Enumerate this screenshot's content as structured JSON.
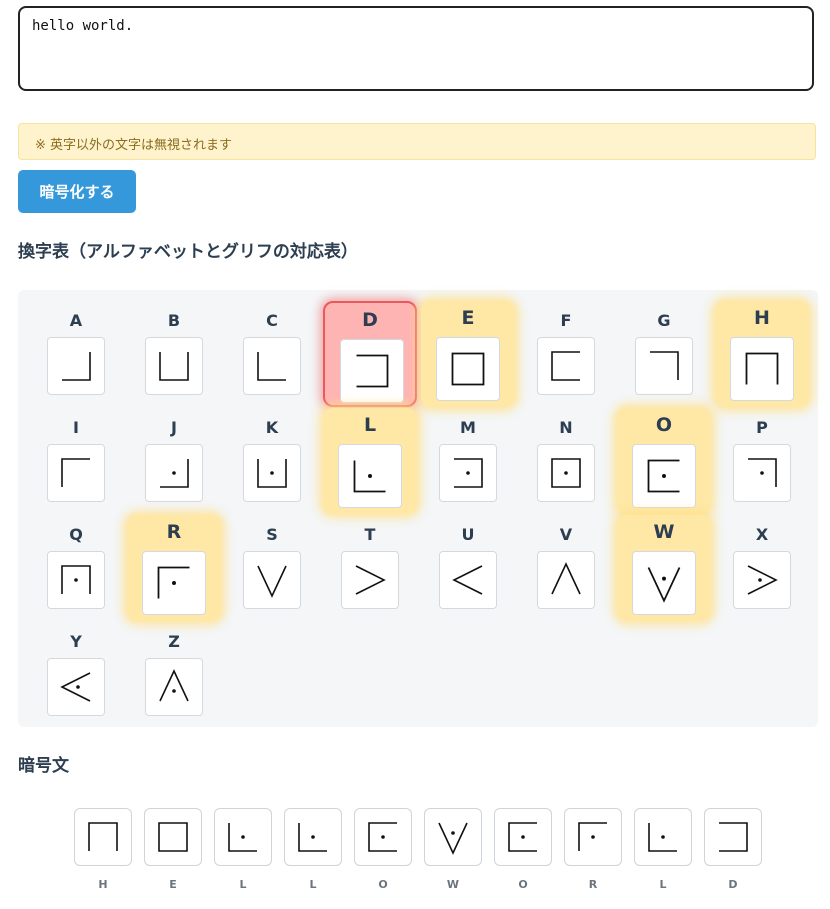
{
  "input": {
    "value": "hello world."
  },
  "notice": {
    "text": "※ 英字以外の文字は無視されます"
  },
  "encode_button": {
    "label": "暗号化する"
  },
  "table_heading": "換字表（アルファベットとグリフの対応表）",
  "cipher_heading": "暗号文",
  "alphabet": [
    {
      "letter": "A",
      "state": "normal"
    },
    {
      "letter": "B",
      "state": "normal"
    },
    {
      "letter": "C",
      "state": "normal"
    },
    {
      "letter": "D",
      "state": "current"
    },
    {
      "letter": "E",
      "state": "highlighted"
    },
    {
      "letter": "F",
      "state": "normal"
    },
    {
      "letter": "G",
      "state": "normal"
    },
    {
      "letter": "H",
      "state": "highlighted"
    },
    {
      "letter": "I",
      "state": "normal"
    },
    {
      "letter": "J",
      "state": "normal"
    },
    {
      "letter": "K",
      "state": "normal"
    },
    {
      "letter": "L",
      "state": "highlighted"
    },
    {
      "letter": "M",
      "state": "normal"
    },
    {
      "letter": "N",
      "state": "normal"
    },
    {
      "letter": "O",
      "state": "highlighted"
    },
    {
      "letter": "P",
      "state": "normal"
    },
    {
      "letter": "Q",
      "state": "normal"
    },
    {
      "letter": "R",
      "state": "highlighted"
    },
    {
      "letter": "S",
      "state": "normal"
    },
    {
      "letter": "T",
      "state": "normal"
    },
    {
      "letter": "U",
      "state": "normal"
    },
    {
      "letter": "V",
      "state": "normal"
    },
    {
      "letter": "W",
      "state": "highlighted"
    },
    {
      "letter": "X",
      "state": "normal"
    },
    {
      "letter": "Y",
      "state": "normal"
    },
    {
      "letter": "Z",
      "state": "normal"
    }
  ],
  "ciphertext": [
    "H",
    "E",
    "L",
    "L",
    "O",
    "W",
    "O",
    "R",
    "L",
    "D"
  ],
  "colors": {
    "button": "#3498db",
    "highlight": "#ffe8a6",
    "current": "#ffb4b4",
    "current_border": "#e9585c",
    "notice_bg": "#fff3cd"
  }
}
